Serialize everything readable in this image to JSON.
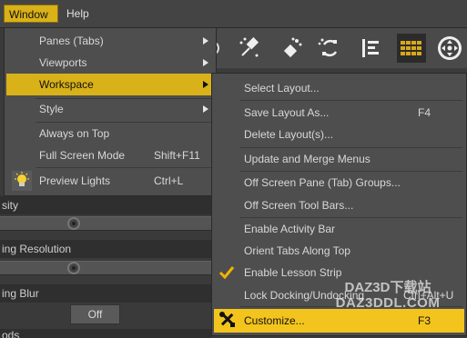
{
  "menubar": {
    "items": [
      {
        "label": "Window",
        "active": true
      },
      {
        "label": "Help",
        "active": false
      }
    ]
  },
  "toolbar": {
    "icons": [
      "spot-light-icon",
      "point-light-icon",
      "rotate-icon",
      "align-icon",
      "grid-icon",
      "navigation-icon"
    ]
  },
  "background": {
    "labels": [
      "sity",
      "ing Resolution",
      "ing Blur",
      "ods"
    ],
    "off_button": "Off"
  },
  "window_menu": {
    "items": [
      {
        "label": "Panes (Tabs)",
        "submenu": true
      },
      {
        "label": "Viewports",
        "submenu": true
      },
      {
        "label": "Workspace",
        "submenu": true,
        "active": true
      },
      {
        "label": "Style",
        "submenu": true
      },
      {
        "label": "Always on Top"
      },
      {
        "label": "Full Screen Mode",
        "shortcut": "Shift+F11"
      },
      {
        "label": "Preview Lights",
        "shortcut": "Ctrl+L",
        "icon": "light-bulb-icon"
      }
    ]
  },
  "workspace_menu": {
    "items": [
      {
        "label": "Select Layout..."
      },
      {
        "label": "Save Layout As...",
        "shortcut": "F4"
      },
      {
        "label": "Delete Layout(s)..."
      },
      {
        "label": "Update and Merge Menus"
      },
      {
        "label": "Off Screen Pane (Tab) Groups..."
      },
      {
        "label": "Off Screen Tool Bars..."
      },
      {
        "label": "Enable Activity Bar"
      },
      {
        "label": "Orient Tabs Along Top"
      },
      {
        "label": "Enable Lesson Strip",
        "checked": true
      },
      {
        "label": "Lock Docking/Undocking",
        "shortcut": "Ctrl+Alt+U"
      },
      {
        "label": "Customize...",
        "shortcut": "F3",
        "active": true,
        "icon": "tools-icon"
      }
    ]
  },
  "watermark": {
    "line1": "DAZ3D下载站",
    "line2": "DAZ3DDL.COM"
  },
  "colors": {
    "accent": "#d9b118",
    "highlight": "#f3c41d",
    "menu_bg": "#4e4e4e",
    "check": "#f0b400"
  }
}
